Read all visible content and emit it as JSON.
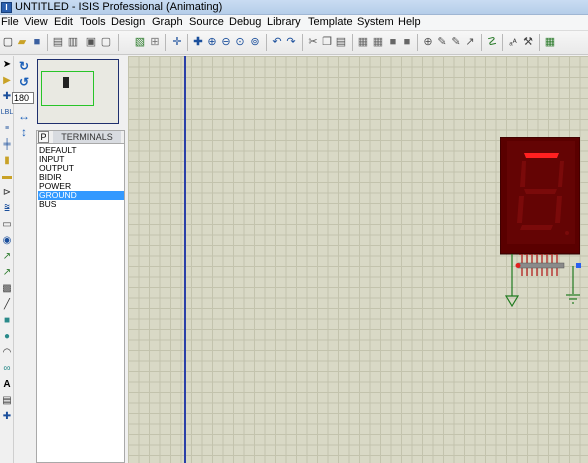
{
  "window": {
    "title": "UNTITLED - ISIS Professional (Animating)",
    "icon": "isis-app-icon"
  },
  "menu": [
    "File",
    "View",
    "Edit",
    "Tools",
    "Design",
    "Graph",
    "Source",
    "Debug",
    "Library",
    "Template",
    "System",
    "Help"
  ],
  "toolbar": {
    "icons": [
      "new-icon",
      "open-icon",
      "save-icon",
      "import-icon",
      "export-icon",
      "print-icon",
      "print-area-icon",
      "refresh-icon",
      "grid-icon",
      "origin-icon",
      "pan-icon",
      "zoom-in-icon",
      "zoom-out-icon",
      "zoom-all-icon",
      "zoom-area-icon",
      "undo-icon",
      "redo-icon",
      "cut-icon",
      "copy-icon",
      "paste-icon",
      "block-copy-icon",
      "block-move-icon",
      "block-rotate-icon",
      "block-delete-icon",
      "pick-device-icon",
      "make-device-icon",
      "packaging-icon",
      "decompose-icon",
      "wire-autorouter-icon",
      "search-tag-icon",
      "property-assign-icon",
      "design-explorer-icon"
    ]
  },
  "left_tools": {
    "rotation_value": "180",
    "mode_icons": [
      "selection-mode-icon",
      "component-mode-icon",
      "junction-dot-icon",
      "wire-label-icon",
      "text-script-icon",
      "bus-icon",
      "subcircuit-icon",
      "terminals-mode-icon",
      "device-pins-icon",
      "graph-mode-icon",
      "tape-recorder-icon",
      "generator-icon",
      "voltage-probe-icon",
      "current-probe-icon",
      "virtual-instrument-icon",
      "line-icon",
      "box-icon",
      "circle-icon",
      "arc-icon",
      "path-icon",
      "text-icon",
      "symbol-icon",
      "marker-icon"
    ],
    "side_icons": [
      "rotate-cw-icon",
      "rotate-ccw-icon",
      "mirror-horizontal-icon",
      "mirror-vertical-icon"
    ]
  },
  "device_panel": {
    "picker_button": "P",
    "title": "TERMINALS",
    "items": [
      "DEFAULT",
      "INPUT",
      "OUTPUT",
      "BIDIR",
      "POWER",
      "GROUND",
      "BUS"
    ],
    "selected_index": 5
  },
  "colors": {
    "canvas_bg": "#d9d9c6",
    "grid_line": "#c3c3ad",
    "sheet_border": "#2a3fa8",
    "display_body": "#5a0000",
    "segment_on": "#ff2020",
    "segment_off": "#7a0a0a",
    "selection": "#3399ff"
  }
}
